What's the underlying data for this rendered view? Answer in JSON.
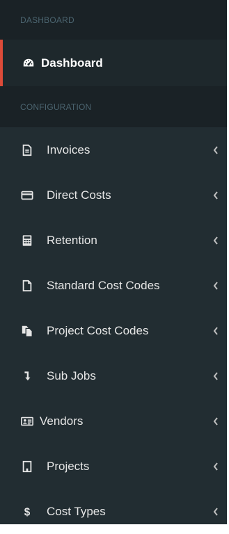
{
  "sections": {
    "dashboard_header": "DASHBOARD",
    "configuration_header": "CONFIGURATION"
  },
  "active": {
    "label": "Dashboard",
    "icon": "tachometer-icon"
  },
  "menu": [
    {
      "label": "Invoices",
      "icon": "invoice-icon"
    },
    {
      "label": "Direct Costs",
      "icon": "credit-card-icon"
    },
    {
      "label": "Retention",
      "icon": "calculator-icon"
    },
    {
      "label": "Standard Cost Codes",
      "icon": "file-icon"
    },
    {
      "label": "Project Cost Codes",
      "icon": "copy-files-icon"
    },
    {
      "label": "Sub Jobs",
      "icon": "level-down-icon"
    },
    {
      "label": "Vendors",
      "icon": "id-card-icon"
    },
    {
      "label": "Projects",
      "icon": "building-icon"
    },
    {
      "label": "Cost Types",
      "icon": "dollar-icon"
    }
  ],
  "colors": {
    "sidebar_bg": "#222d32",
    "header_bg": "#1a2226",
    "active_bg": "#1e282c",
    "accent": "#dd4b39",
    "text": "#e6e6e6",
    "header_text": "#4b646f"
  }
}
